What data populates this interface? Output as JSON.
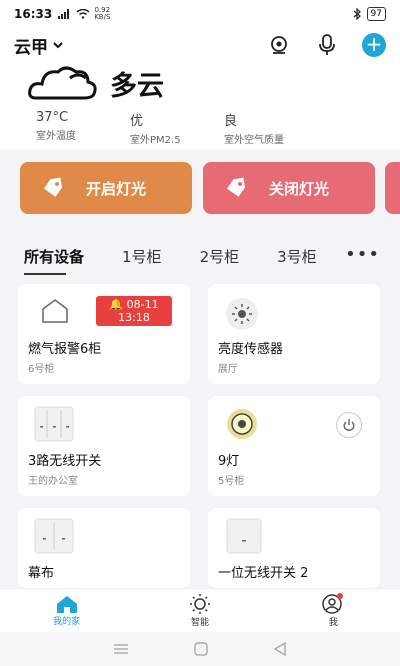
{
  "status_bar": {
    "time": "16:33",
    "net_speed": "0.92\nKB/S",
    "battery": "97"
  },
  "header": {
    "home_name": "云甲",
    "home_icon": "chevron-down-icon",
    "actions": [
      "camera-icon",
      "microphone-icon",
      "add-icon"
    ],
    "add_color": "#1fa5d8"
  },
  "weather": {
    "condition": "多云",
    "icon": "cloud-icon",
    "stats": [
      {
        "value": "37°C",
        "label": "室外温度"
      },
      {
        "value": "优",
        "label": "室外PM2.5"
      },
      {
        "value": "良",
        "label": "室外空气质量"
      }
    ]
  },
  "scenes": [
    {
      "label": "开启灯光",
      "color": "#e08a4a"
    },
    {
      "label": "关闭灯光",
      "color": "#e76b74"
    }
  ],
  "tabs": [
    "所有设备",
    "1号柜",
    "2号柜",
    "3号柜"
  ],
  "active_tab": "所有设备",
  "devices": [
    {
      "name": "燃气报警6柜",
      "room": "6号柜",
      "icon": "house-icon",
      "alarm": {
        "date": "08-11",
        "time": "13:18"
      }
    },
    {
      "name": "亮度传感器",
      "room": "展厅",
      "icon": "sun-sensor-icon"
    },
    {
      "name": "3路无线开关",
      "room": "王的办公室",
      "icon": "triple-switch-icon"
    },
    {
      "name": "9灯",
      "room": "5号柜",
      "icon": "bulb-icon",
      "power_icon": "power-icon"
    },
    {
      "name": "幕布",
      "room": "",
      "icon": "double-switch-icon"
    },
    {
      "name": "一位无线开关 2",
      "room": "",
      "icon": "single-switch-icon"
    }
  ],
  "bottom_nav": [
    {
      "label": "我的家",
      "icon": "home-icon",
      "active": true
    },
    {
      "label": "智能",
      "icon": "sun-icon",
      "active": false
    },
    {
      "label": "我",
      "icon": "user-icon",
      "active": false
    }
  ],
  "system_nav": [
    "menu-icon",
    "home-square-icon",
    "back-icon"
  ]
}
